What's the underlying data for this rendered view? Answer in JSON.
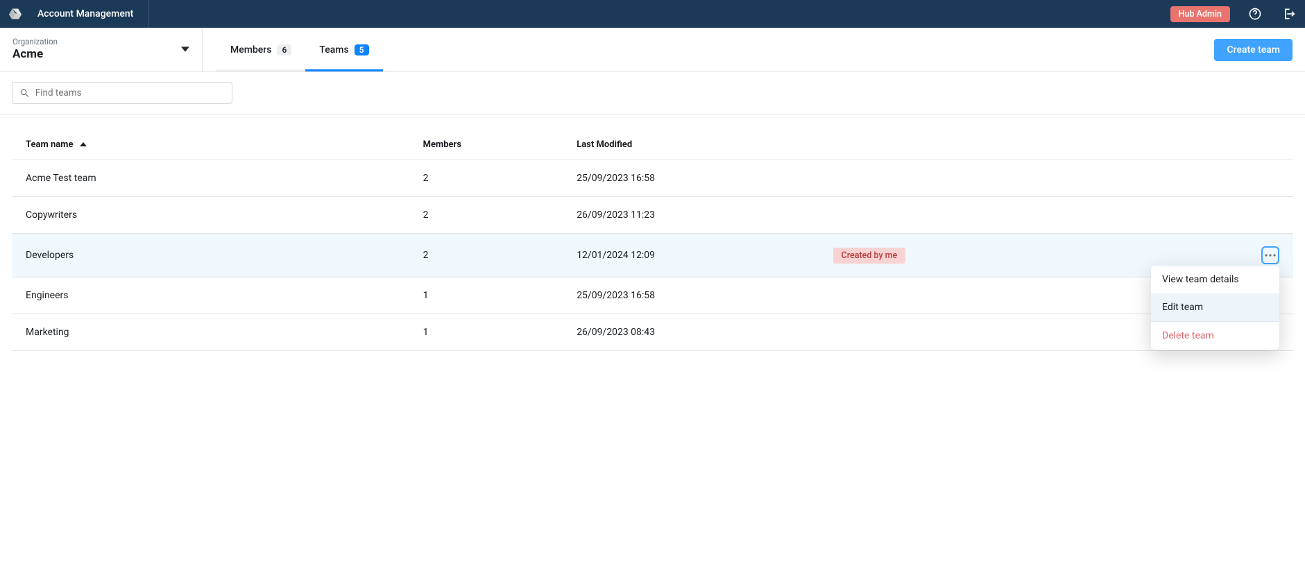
{
  "header": {
    "title": "Account Management",
    "hub_admin": "Hub Admin"
  },
  "org": {
    "label": "Organization",
    "name": "Acme"
  },
  "tabs": {
    "members": {
      "label": "Members",
      "count": "6"
    },
    "teams": {
      "label": "Teams",
      "count": "5"
    }
  },
  "buttons": {
    "create_team": "Create team"
  },
  "search": {
    "placeholder": "Find teams"
  },
  "table": {
    "headers": {
      "name": "Team name",
      "members": "Members",
      "modified": "Last Modified"
    },
    "rows": [
      {
        "name": "Acme Test team",
        "members": "2",
        "modified": "25/09/2023 16:58",
        "badge": "",
        "highlight": false,
        "menu": false
      },
      {
        "name": "Copywriters",
        "members": "2",
        "modified": "26/09/2023 11:23",
        "badge": "",
        "highlight": false,
        "menu": false
      },
      {
        "name": "Developers",
        "members": "2",
        "modified": "12/01/2024 12:09",
        "badge": "Created by me",
        "highlight": true,
        "menu": true
      },
      {
        "name": "Engineers",
        "members": "1",
        "modified": "25/09/2023 16:58",
        "badge": "",
        "highlight": false,
        "menu": false
      },
      {
        "name": "Marketing",
        "members": "1",
        "modified": "26/09/2023 08:43",
        "badge": "",
        "highlight": false,
        "menu": false
      }
    ]
  },
  "context_menu": {
    "view": "View team details",
    "edit": "Edit team",
    "delete": "Delete team"
  }
}
